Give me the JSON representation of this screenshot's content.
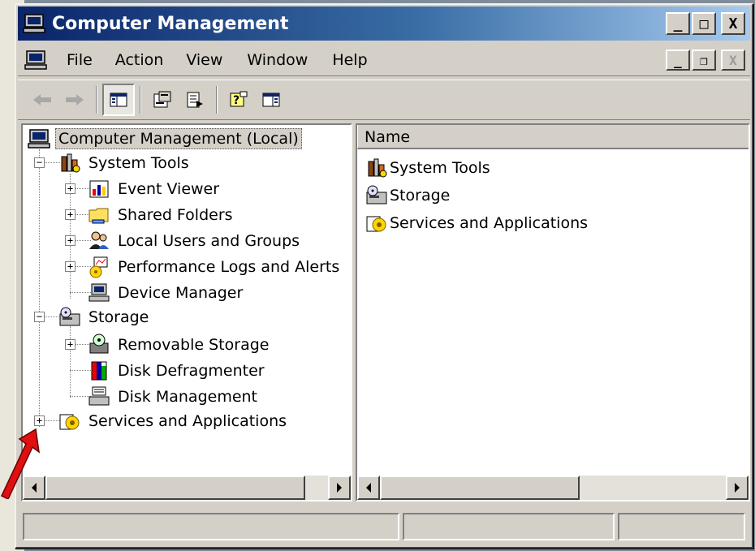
{
  "window": {
    "title": "Computer Management",
    "buttons": {
      "minimize": "_",
      "maximize": "□",
      "close": "X"
    }
  },
  "menu": {
    "items": [
      {
        "label": "File",
        "accel": "F"
      },
      {
        "label": "Action",
        "accel": "A"
      },
      {
        "label": "View",
        "accel": "V"
      },
      {
        "label": "Window",
        "accel": "W"
      },
      {
        "label": "Help",
        "accel": "H"
      }
    ],
    "mdi_buttons": {
      "minimize": "_",
      "restore": "❐",
      "close": "X"
    }
  },
  "toolbar": {
    "buttons": [
      "back-icon",
      "forward-icon",
      "show-hide-tree-icon",
      "properties-icon",
      "export-list-icon",
      "help-icon",
      "show-hide-action-pane-icon"
    ]
  },
  "tree": {
    "root": "Computer Management (Local)",
    "system_tools": "System Tools",
    "event_viewer": "Event Viewer",
    "shared_folders": "Shared Folders",
    "local_users": "Local Users and Groups",
    "perf_logs": "Performance Logs and Alerts",
    "device_manager": "Device Manager",
    "storage": "Storage",
    "removable_storage": "Removable Storage",
    "disk_defrag": "Disk Defragmenter",
    "disk_management": "Disk Management",
    "services_apps": "Services and Applications"
  },
  "list": {
    "column_name": "Name",
    "items": [
      "System Tools",
      "Storage",
      "Services and Applications"
    ]
  },
  "colors": {
    "title_gradient_start": "#0a246a",
    "title_gradient_end": "#a6caf0",
    "face": "#d4d0c8",
    "annotation_arrow": "#e01010"
  }
}
